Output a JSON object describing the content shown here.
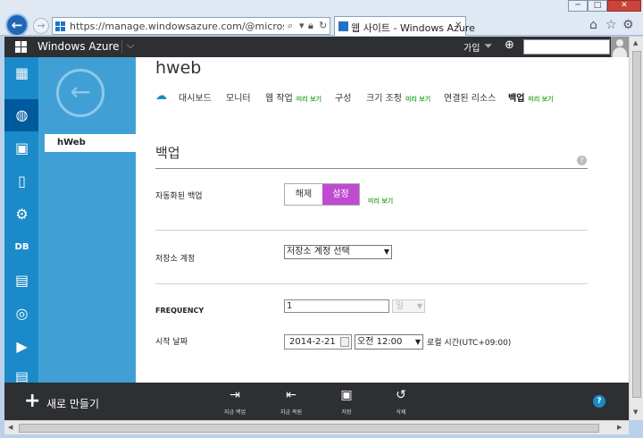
{
  "browser": {
    "url": "https://manage.windowsazure.com/@microsoft.onmicrosoft.c",
    "tab_title": "웹 사이트 - Windows Azure",
    "tab_close": "✕",
    "window_controls": {
      "minimize": "─",
      "maximize": "□",
      "close": "✕"
    },
    "icons": [
      "back-arrow",
      "forward-arrow",
      "search",
      "lock",
      "refresh",
      "home",
      "favorites-star",
      "settings-gear"
    ]
  },
  "portal": {
    "title": "Windows Azure",
    "signup": "가입",
    "dropdown_glyph": "⌵",
    "search_placeholder": ""
  },
  "left_nav": {
    "items": [
      {
        "icon": "all-items-grid-icon",
        "glyph": "▦"
      },
      {
        "icon": "web-sites-icon",
        "glyph": "◍"
      },
      {
        "icon": "virtual-machines-icon",
        "glyph": "▣"
      },
      {
        "icon": "mobile-services-icon",
        "glyph": "▯"
      },
      {
        "icon": "cloud-services-icon",
        "glyph": "⚙"
      },
      {
        "icon": "sql-databases-icon",
        "glyph": "DB"
      },
      {
        "icon": "storage-icon",
        "glyph": "▤"
      },
      {
        "icon": "hdinsight-icon",
        "glyph": "◎"
      },
      {
        "icon": "media-services-icon",
        "glyph": "▶"
      },
      {
        "icon": "reports-icon",
        "glyph": "▤"
      }
    ]
  },
  "secondary_nav": {
    "back_glyph": "←",
    "item": "hWeb"
  },
  "page": {
    "title": "hweb",
    "tabs": [
      {
        "label": "대시보드",
        "preview": ""
      },
      {
        "label": "모니터",
        "preview": ""
      },
      {
        "label": "웹 작업",
        "preview": "미리 보기"
      },
      {
        "label": "구성",
        "preview": ""
      },
      {
        "label": "크기 조정",
        "preview": "미리 보기"
      },
      {
        "label": "연결된 리소스",
        "preview": ""
      },
      {
        "label": "백업",
        "preview": "미리 보기"
      }
    ],
    "active_tab": "백업",
    "section_title": "백업",
    "help_glyph": "?"
  },
  "form": {
    "automated_backup": {
      "label": "자동화된 백업",
      "off": "해제",
      "on": "설정",
      "value": "설정",
      "preview": "미리 보기"
    },
    "storage_account": {
      "label": "저장소 계정",
      "value": "저장소 계정 선택"
    },
    "frequency": {
      "label": "FREQUENCY",
      "value": "1",
      "unit": "일"
    },
    "start_date": {
      "label": "시작 날짜",
      "date": "2014-2-21",
      "time": "오전 12:00",
      "timezone": "로컬 시간(UTC+09:00)"
    }
  },
  "command_bar": {
    "new_plus": "+",
    "new_label": "새로 만들기",
    "buttons": [
      {
        "icon": "backup-now-icon",
        "glyph": "⇥",
        "label": "지금 백업"
      },
      {
        "icon": "restore-now-icon",
        "glyph": "⇤",
        "label": "지금 복원"
      },
      {
        "icon": "save-icon",
        "glyph": "▣",
        "label": "저장"
      },
      {
        "icon": "discard-icon",
        "glyph": "↺",
        "label": "삭제"
      }
    ],
    "help": "?"
  },
  "colors": {
    "accent_blue": "#1b8ac8",
    "toggle_on": "#c04bd1",
    "preview_green": "#3aa935",
    "header_dark": "#2d2f33"
  }
}
